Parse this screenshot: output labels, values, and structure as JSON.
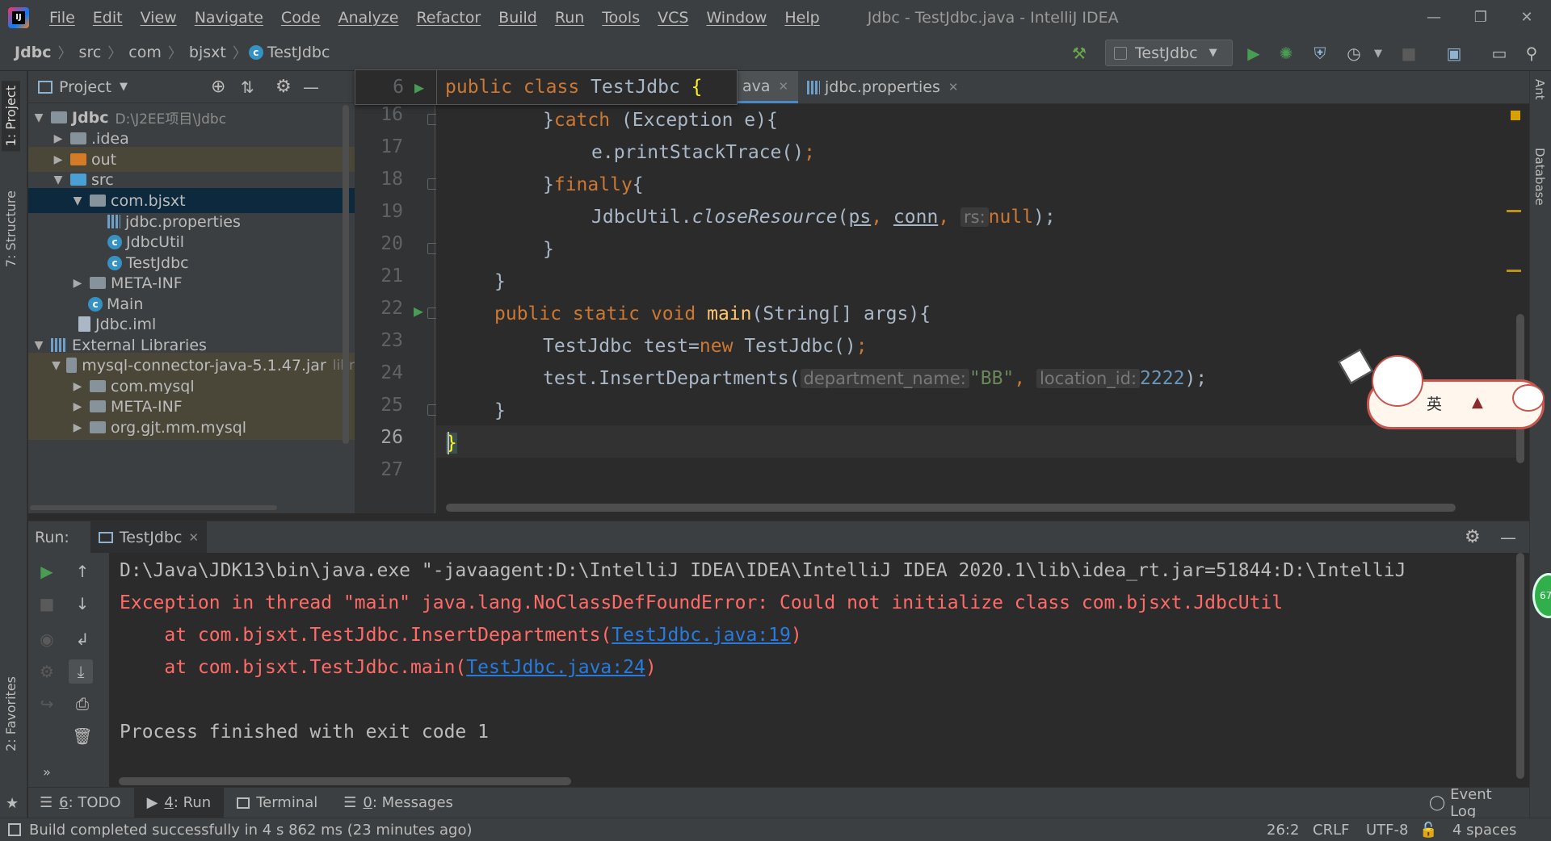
{
  "titlebar": {
    "logo": "IJ",
    "menu": [
      "File",
      "Edit",
      "View",
      "Navigate",
      "Code",
      "Analyze",
      "Refactor",
      "Build",
      "Run",
      "Tools",
      "VCS",
      "Window",
      "Help"
    ],
    "window_title": "Jdbc - TestJdbc.java - IntelliJ IDEA"
  },
  "navbar": {
    "crumbs": [
      "Jdbc",
      "src",
      "com",
      "bjsxt",
      "TestJdbc"
    ],
    "run_config": "TestJdbc"
  },
  "left_stripe": {
    "project_tab": "1: Project",
    "structure_tab": "7: Structure",
    "favorites_tab": "2: Favorites"
  },
  "right_stripe": {
    "ant": "Ant",
    "database": "Database"
  },
  "project": {
    "header": "Project",
    "tree": [
      {
        "label": "Jdbc",
        "extra": "D:\\J2EE项目\\Jdbc"
      },
      {
        "label": ".idea"
      },
      {
        "label": "out"
      },
      {
        "label": "src"
      },
      {
        "label": "com.bjsxt"
      },
      {
        "label": "jdbc.properties"
      },
      {
        "label": "JdbcUtil"
      },
      {
        "label": "TestJdbc"
      },
      {
        "label": "META-INF"
      },
      {
        "label": "Main"
      },
      {
        "label": "Jdbc.iml"
      },
      {
        "label": "External Libraries"
      },
      {
        "label": "mysql-connector-java-5.1.47.jar",
        "extra": "libr"
      },
      {
        "label": "com.mysql"
      },
      {
        "label": "META-INF"
      },
      {
        "label": "org.gjt.mm.mysql"
      }
    ]
  },
  "editor": {
    "tabs": [
      {
        "label": "ava"
      },
      {
        "label": "jdbc.properties"
      }
    ],
    "sticky_line_no": "6",
    "sticky_code": [
      "public class ",
      "TestJdbc",
      " {"
    ],
    "line_numbers": [
      "16",
      "17",
      "18",
      "19",
      "20",
      "21",
      "22",
      "23",
      "24",
      "25",
      "26",
      "27"
    ],
    "lines": {
      "l16": [
        "}catch",
        " (Exception e){"
      ],
      "l17": [
        "e.printStackTrace()",
        ";"
      ],
      "l18": [
        "}finally",
        "{"
      ],
      "l19": [
        "JdbcUtil.",
        "closeResource",
        "(",
        "ps",
        ", ",
        "conn",
        ", ",
        "rs:",
        "null",
        ");"
      ],
      "l20": [
        "}"
      ],
      "l21": [
        "}"
      ],
      "l22": [
        "public static void ",
        "main",
        "(String[] args){"
      ],
      "l23": [
        "TestJdbc test=",
        "new ",
        "TestJdbc()",
        ";"
      ],
      "l24": [
        "test.InsertDepartments(",
        "department_name:",
        "\"BB\"",
        ", ",
        "location_id:",
        "2222",
        ");"
      ],
      "l25": [
        "}"
      ],
      "l26": [
        "}"
      ]
    }
  },
  "sticker": {
    "text": "英"
  },
  "run_panel": {
    "label": "Run:",
    "tab": "TestJdbc",
    "console": {
      "cmd": "D:\\Java\\JDK13\\bin\\java.exe \"-javaagent:D:\\IntelliJ IDEA\\IDEA\\IntelliJ IDEA 2020.1\\lib\\idea_rt.jar=51844:D:\\IntelliJ",
      "err1": "Exception in thread \"main\" java.lang.NoClassDefFoundError: Could not initialize class com.bjsxt.JdbcUtil",
      "err2_prefix": "    at com.bjsxt.TestJdbc.InsertDepartments(",
      "err2_link": "TestJdbc.java:19",
      "err2_suffix": ")",
      "err3_prefix": "    at com.bjsxt.TestJdbc.main(",
      "err3_link": "TestJdbc.java:24",
      "err3_suffix": ")",
      "finish": "Process finished with exit code 1"
    },
    "badge": "67"
  },
  "bottom_tabs": [
    {
      "num": "6",
      "label": ": TODO"
    },
    {
      "num": "4",
      "label": ": Run"
    },
    {
      "num": "",
      "label": "Terminal"
    },
    {
      "num": "0",
      "label": ": Messages"
    }
  ],
  "event_log": "Event Log",
  "status": {
    "message": "Build completed successfully in 4 s 862 ms (23 minutes ago)",
    "position": "26:2",
    "line_sep": "CRLF",
    "encoding": "UTF-8",
    "indent": "4 spaces"
  },
  "colors": {
    "keyword": "#cc7832",
    "function": "#ffc66d",
    "number": "#6897bb",
    "string": "#6a8759",
    "error": "#ff6b68",
    "link": "#287bde",
    "run_green": "#499c54"
  }
}
